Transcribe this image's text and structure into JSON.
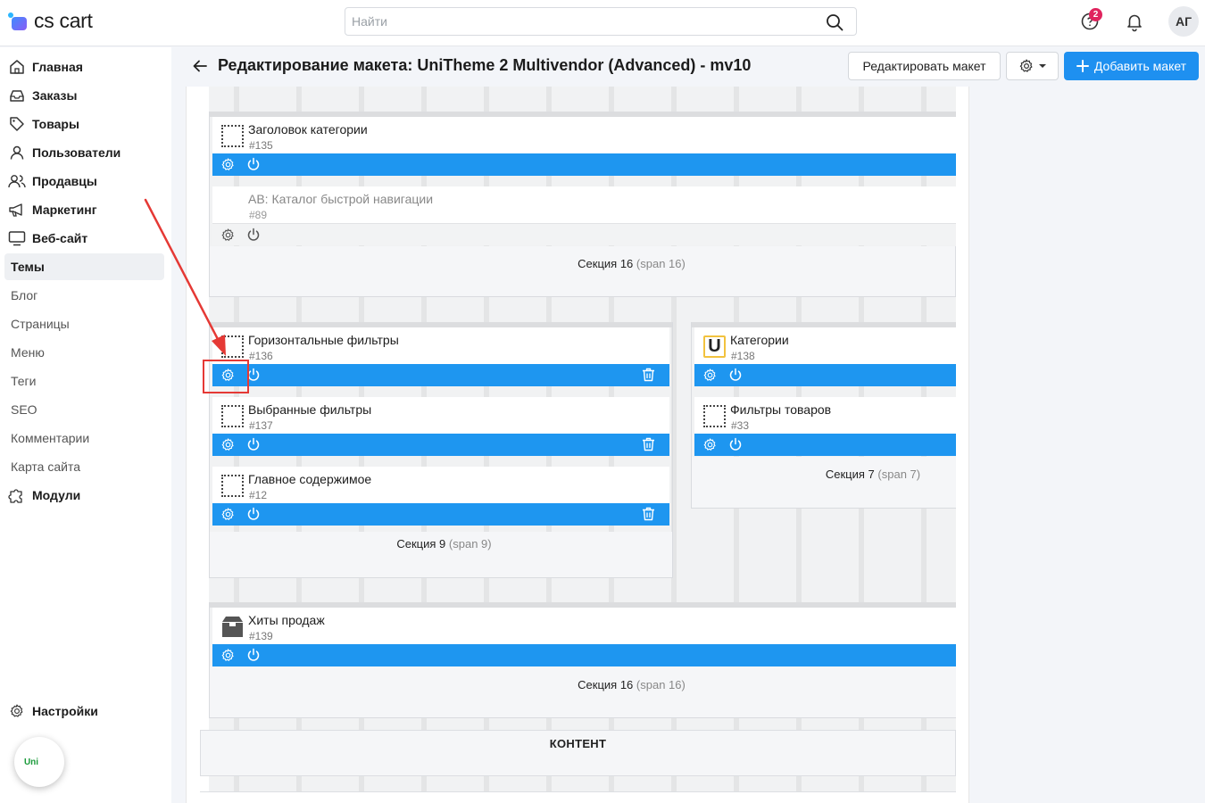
{
  "app": {
    "logo_text": "cs cart"
  },
  "search": {
    "placeholder": "Найти"
  },
  "header": {
    "notifications_count": "2",
    "avatar_initials": "АГ"
  },
  "sidebar": {
    "items": [
      {
        "label": "Главная",
        "icon": "home-icon"
      },
      {
        "label": "Заказы",
        "icon": "inbox-icon"
      },
      {
        "label": "Товары",
        "icon": "tag-icon"
      },
      {
        "label": "Пользователи",
        "icon": "user-icon"
      },
      {
        "label": "Продавцы",
        "icon": "users-icon"
      },
      {
        "label": "Маркетинг",
        "icon": "megaphone-icon"
      },
      {
        "label": "Веб-сайт",
        "icon": "monitor-icon"
      },
      {
        "label": "Темы"
      },
      {
        "label": "Блог"
      },
      {
        "label": "Страницы"
      },
      {
        "label": "Меню"
      },
      {
        "label": "Теги"
      },
      {
        "label": "SEO"
      },
      {
        "label": "Комментарии"
      },
      {
        "label": "Карта сайта"
      },
      {
        "label": "Модули",
        "icon": "puzzle-icon"
      }
    ],
    "settings_label": "Настройки",
    "uni_label": "Uni"
  },
  "page": {
    "title": "Редактирование макета: UniTheme 2 Multivendor (Advanced) - mv10",
    "edit_layout_label": "Редактировать макет",
    "add_layout_label": "Добавить макет"
  },
  "blocks": {
    "b135": {
      "name": "Заголовок категории",
      "id": "#135"
    },
    "b89": {
      "name": "AB: Каталог быстрой навигации",
      "id": "#89"
    },
    "b136": {
      "name": "Горизонтальные фильтры",
      "id": "#136"
    },
    "b137": {
      "name": "Выбранные фильтры",
      "id": "#137"
    },
    "b12": {
      "name": "Главное содержимое",
      "id": "#12"
    },
    "b138": {
      "name": "Категории",
      "id": "#138",
      "icon_letter": "U"
    },
    "b33": {
      "name": "Фильтры товаров",
      "id": "#33"
    },
    "b139": {
      "name": "Хиты продаж",
      "id": "#139"
    }
  },
  "sections": {
    "s16a": {
      "label": "Секция 16",
      "span": "(span 16)"
    },
    "s9": {
      "label": "Секция 9",
      "span": "(span 9)"
    },
    "s7": {
      "label": "Секция 7",
      "span": "(span 7)"
    },
    "s16b": {
      "label": "Секция 16",
      "span": "(span 16)"
    }
  },
  "content_label": "КОНТЕНТ",
  "colors": {
    "accent": "#1e96f0",
    "add_button": "#1e90f0",
    "highlight": "#e53935",
    "badge": "#e0245e"
  }
}
